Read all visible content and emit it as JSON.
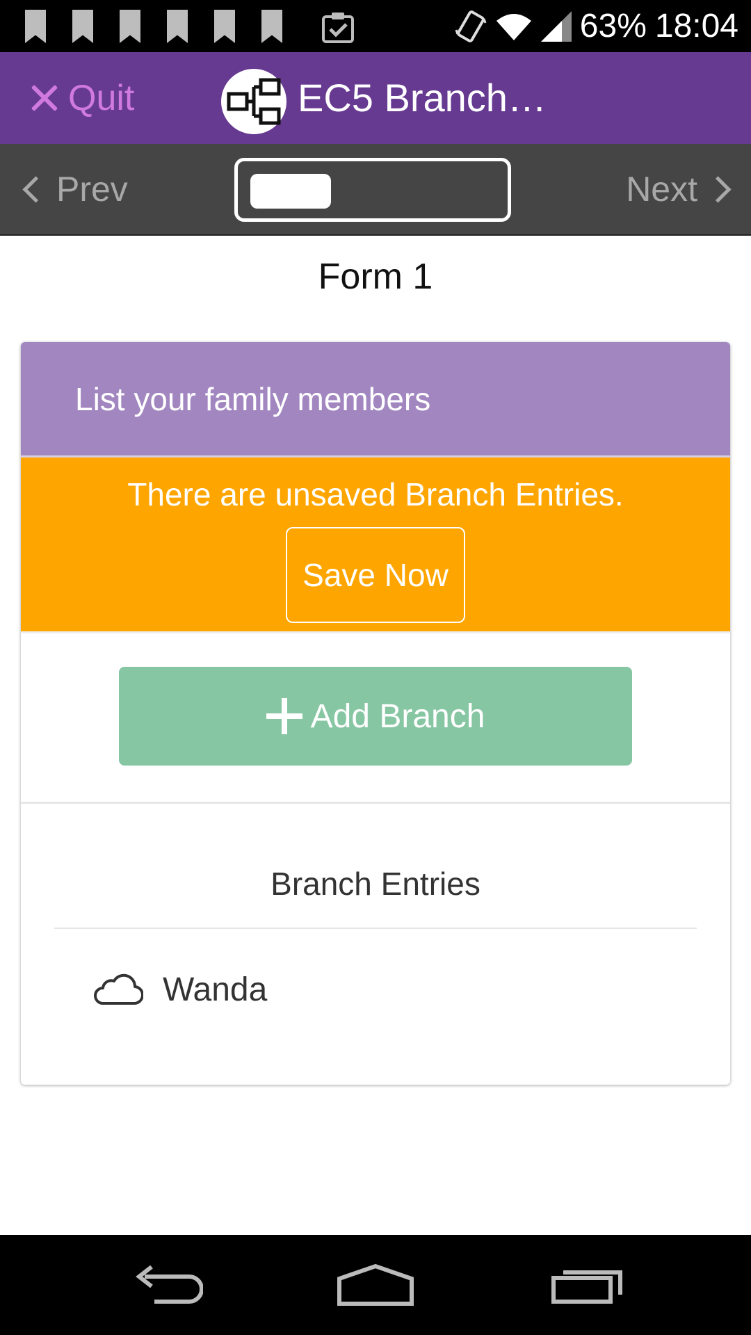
{
  "status_bar": {
    "battery": "63%",
    "time": "18:04",
    "notification_icons": [
      "bookmark-icon",
      "bookmark-icon",
      "bookmark-icon",
      "bookmark-icon",
      "bookmark-icon",
      "bookmark-icon",
      "clipboard-check-icon"
    ]
  },
  "app_bar": {
    "quit_label": "Quit",
    "title": "EC5 Branch…"
  },
  "nav_bar": {
    "prev_label": "Prev",
    "next_label": "Next",
    "progress_fraction": 0.33
  },
  "form": {
    "title": "Form 1"
  },
  "card": {
    "header": "List your family members",
    "unsaved_message": "There are unsaved Branch Entries.",
    "save_label": "Save Now",
    "add_label": "Add Branch",
    "entries_title": "Branch Entries",
    "entries": [
      {
        "name": "Wanda",
        "icon": "cloud-icon"
      }
    ]
  },
  "colors": {
    "app_bar": "#673a91",
    "quit": "#d07ae0",
    "nav_bar": "#454545",
    "card_header": "#a286c0",
    "unsaved": "#ffa500",
    "add_button": "#86c6a3"
  }
}
